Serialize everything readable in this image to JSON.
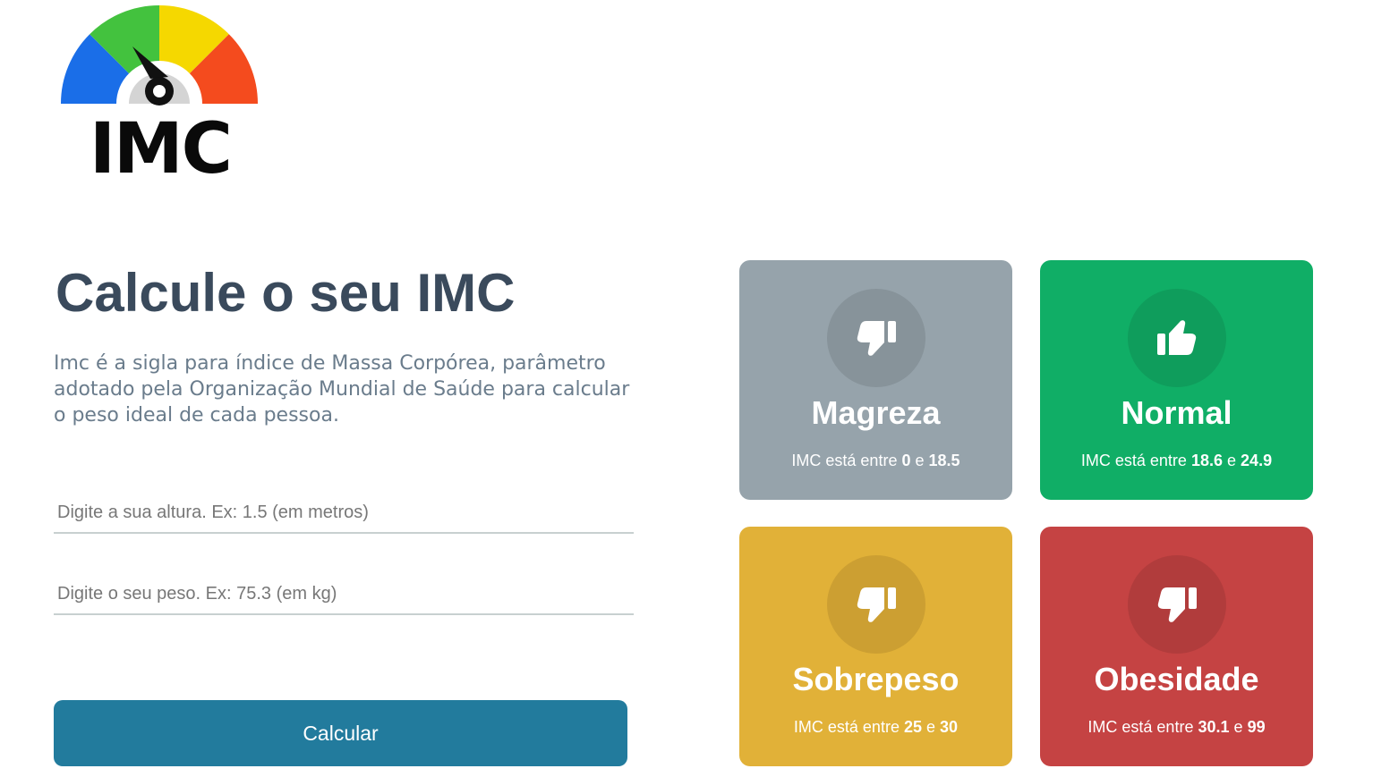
{
  "logo": {
    "text": "IMC"
  },
  "intro": {
    "title": "Calcule o seu IMC",
    "description": "Imc é a sigla para índice de Massa Corpórea, parâmetro adotado pela Organização Mundial de Saúde para calcular o peso ideal de cada pessoa."
  },
  "form": {
    "height_placeholder": "Digite a sua altura. Ex: 1.5 (em metros)",
    "weight_placeholder": "Digite o seu peso. Ex: 75.3 (em kg)",
    "height_value": "",
    "weight_value": "",
    "button_label": "Calcular"
  },
  "cards": [
    {
      "title": "Magreza",
      "range_prefix": "IMC está entre",
      "min": "0",
      "joiner": "e",
      "max": "18.5",
      "icon": "thumbs-down-icon",
      "color": "#96a3ab"
    },
    {
      "title": "Normal",
      "range_prefix": "IMC está entre",
      "min": "18.6",
      "joiner": "e",
      "max": "24.9",
      "icon": "thumbs-up-icon",
      "color": "#10ae66"
    },
    {
      "title": "Sobrepeso",
      "range_prefix": "IMC está entre",
      "min": "25",
      "joiner": "e",
      "max": "30",
      "icon": "thumbs-down-icon",
      "color": "#e1b138"
    },
    {
      "title": "Obesidade",
      "range_prefix": "IMC está entre",
      "min": "30.1",
      "joiner": "e",
      "max": "99",
      "icon": "thumbs-down-icon",
      "color": "#c54343"
    }
  ]
}
